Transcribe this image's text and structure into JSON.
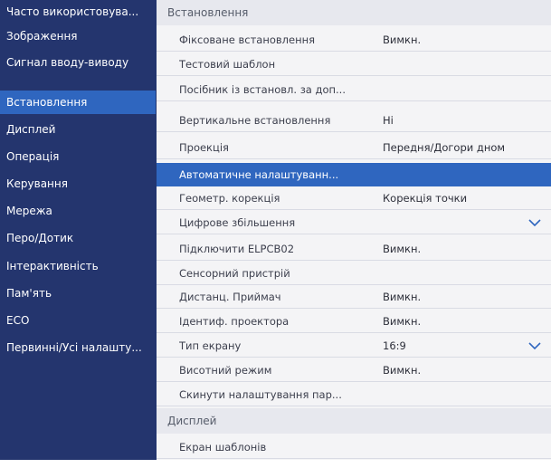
{
  "sidebar": {
    "items": [
      {
        "label": "Часто використовува..."
      },
      {
        "label": "Зображення"
      },
      {
        "label": "Сигнал вводу-виводу"
      },
      {
        "label": "Встановлення"
      },
      {
        "label": "Дисплей"
      },
      {
        "label": "Операція"
      },
      {
        "label": "Керування"
      },
      {
        "label": "Мережа"
      },
      {
        "label": "Перо/Дотик"
      },
      {
        "label": "Інтерактивність"
      },
      {
        "label": "Пам'ять"
      },
      {
        "label": "ECO"
      },
      {
        "label": "Первинні/Усі налашту..."
      }
    ],
    "selected": "Встановлення"
  },
  "main": {
    "section_installation": "Встановлення",
    "rows": [
      {
        "label": "Фіксоване встановлення",
        "value": "Вимкн."
      },
      {
        "label": "Тестовий шаблон",
        "value": ""
      },
      {
        "label": "Посібник із встановл. за доп...",
        "value": ""
      },
      {
        "label": "Вертикальне встановлення",
        "value": "Ні"
      },
      {
        "label": "Проекція",
        "value": "Передня/Догори дном"
      },
      {
        "label": "Автоматичне налаштуванн...",
        "value": ""
      },
      {
        "label": "Геометр. корекція",
        "value": "Корекція точки"
      },
      {
        "label": "Цифрове збільшення",
        "value": "",
        "icon": "chevron-down-icon"
      },
      {
        "label": "Підключити ELPCB02",
        "value": "Вимкн."
      },
      {
        "label": "Сенсорний пристрій",
        "value": ""
      },
      {
        "label": "Дистанц. Приймач",
        "value": "Вимкн."
      },
      {
        "label": "Ідентиф. проектора",
        "value": "Вимкн."
      },
      {
        "label": "Тип екрану",
        "value": "16:9",
        "icon": "chevron-down-icon"
      },
      {
        "label": "Висотний режим",
        "value": "Вимкн."
      },
      {
        "label": "Скинути налаштування пар...",
        "value": ""
      }
    ],
    "selected_row": "Автоматичне налаштуванн...",
    "section_display": "Дисплей",
    "display_rows": [
      {
        "label": "Екран шаблонів"
      }
    ]
  },
  "colors": {
    "sidebar_bg": "#24356e",
    "selection": "#2f66bf",
    "panel_bg": "#f4f4f6",
    "header_bg": "#e7e8ee",
    "label_text": "#3c3f4d",
    "value_text": "#2d2f3a"
  }
}
